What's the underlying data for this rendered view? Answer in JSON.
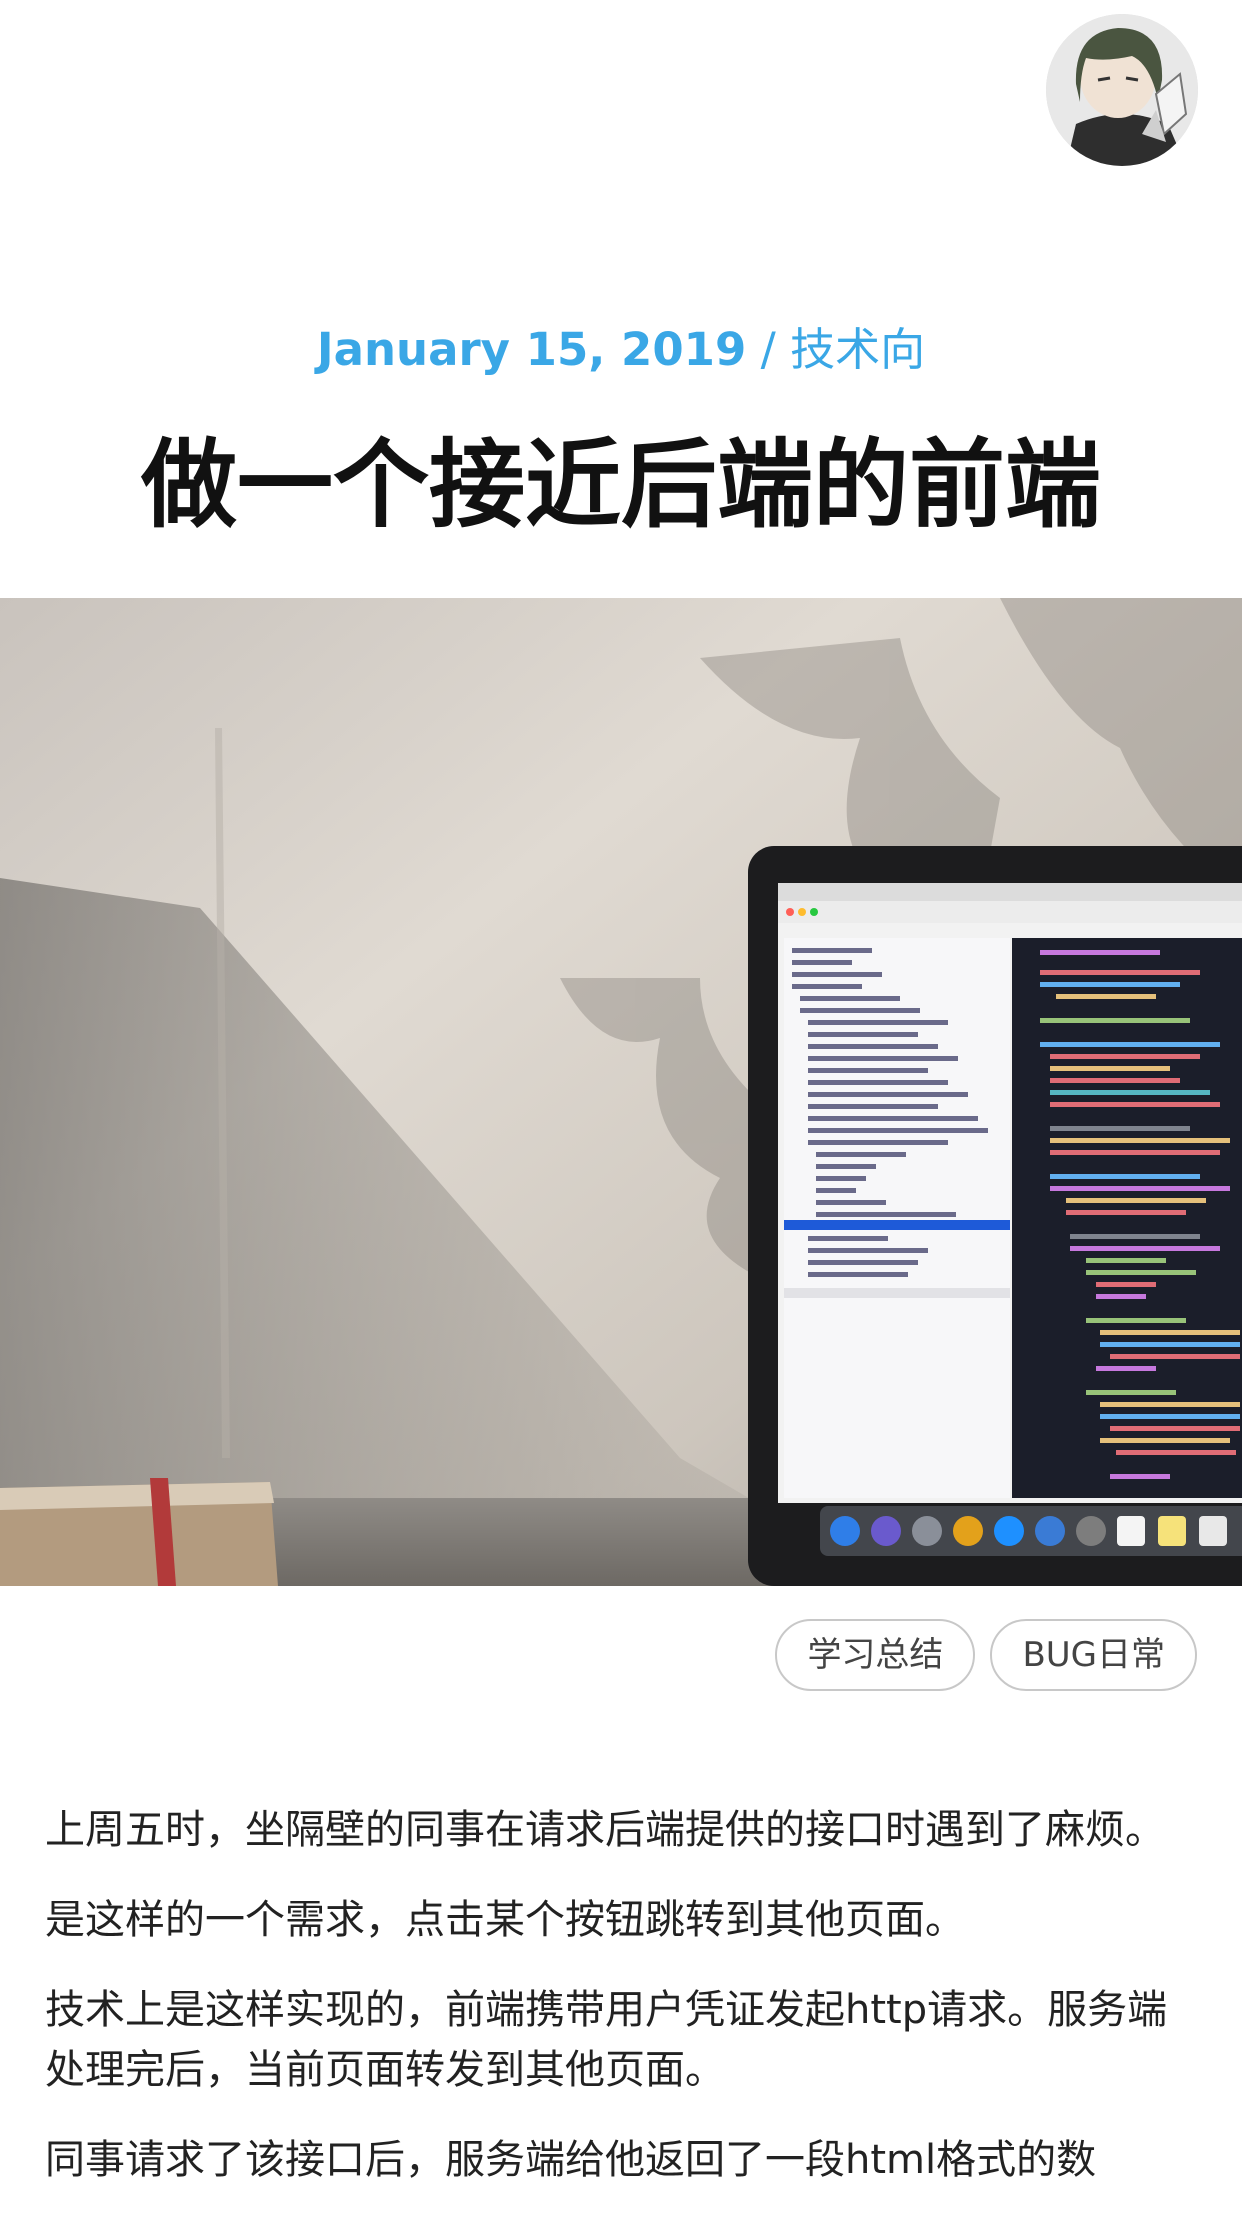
{
  "post": {
    "date": "January 15, 2019",
    "separator": " / ",
    "category": "技术向",
    "title": "做一个接近后端的前端",
    "tags": [
      "学习总结",
      "BUG日常"
    ],
    "paragraphs": [
      "上周五时，坐隔壁的同事在请求后端提供的接口时遇到了麻烦。",
      "是这样的一个需求，点击某个按钮跳转到其他页面。",
      "技术上是这样实现的，前端携带用户凭证发起http请求。服务端处理完后，当前页面转发到其他页面。",
      "同事请求了该接口后，服务端给他返回了一段html格式的数"
    ]
  },
  "colors": {
    "accent": "#3aa7e6",
    "title": "#111111",
    "text": "#222222"
  },
  "icons": {
    "avatar": "anime-girl-avatar",
    "hero": "laptop-with-code-hero-image"
  }
}
